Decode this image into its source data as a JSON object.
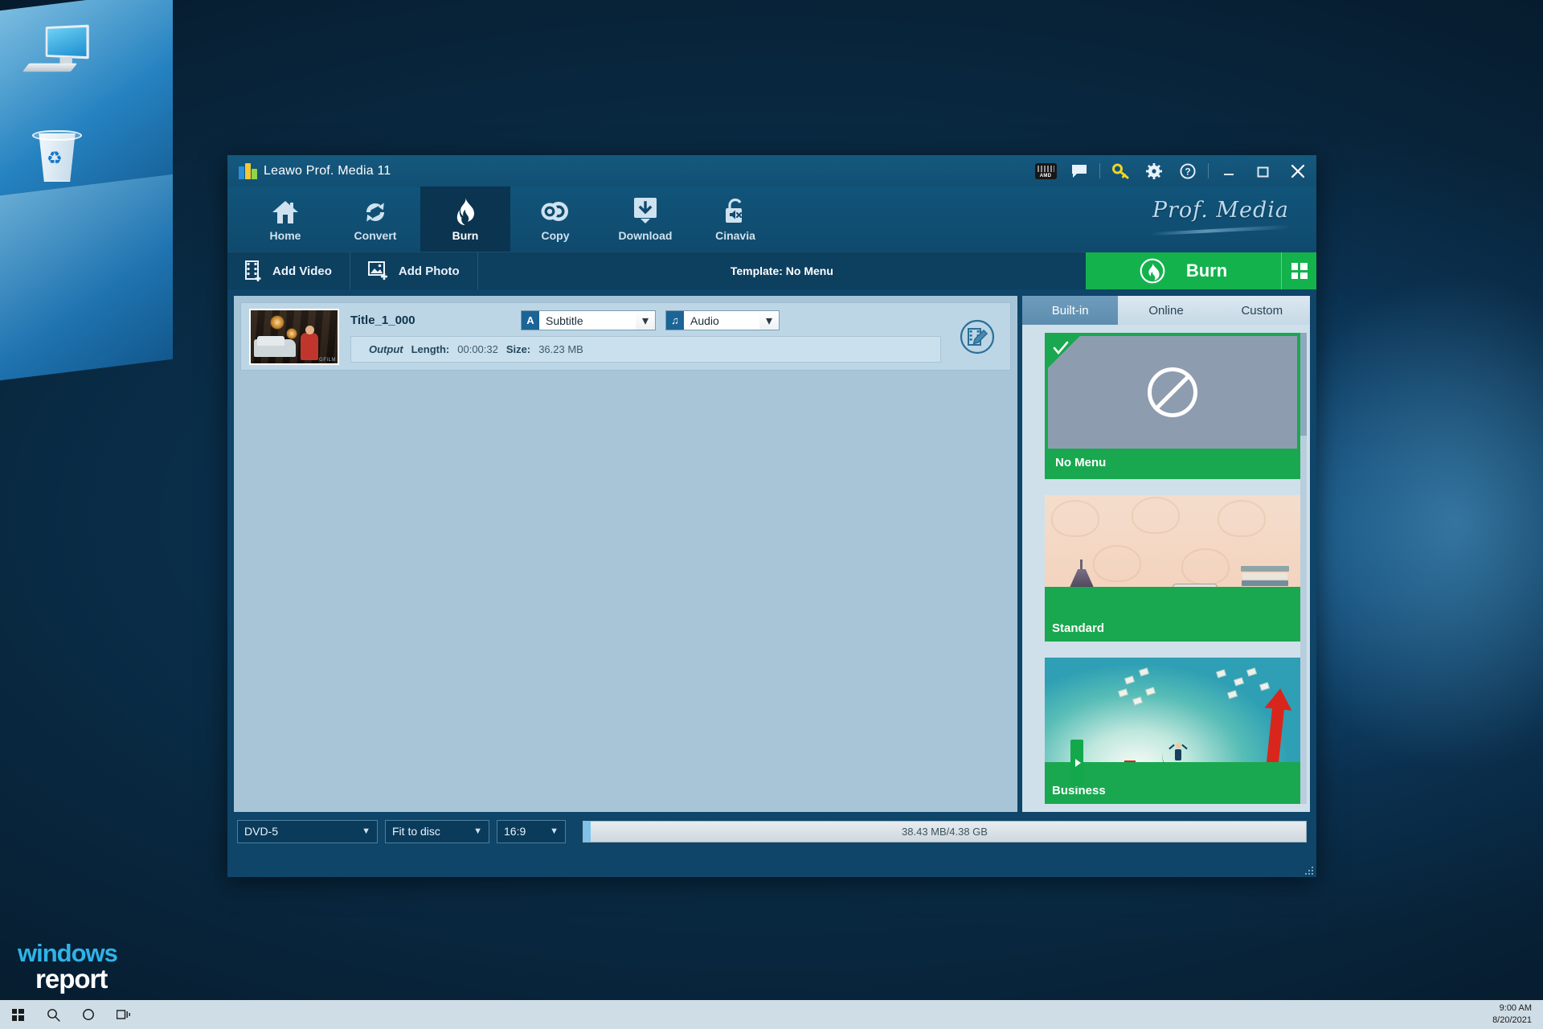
{
  "desktop": {
    "icons": [
      {
        "name": "this-pc",
        "label": ""
      },
      {
        "name": "recycle-bin",
        "label": ""
      }
    ],
    "watermark": {
      "line1": "windows",
      "line2": "report"
    }
  },
  "taskbar": {
    "buttons": [
      {
        "icon": "windows-start-icon",
        "label": ""
      },
      {
        "icon": "search-icon",
        "label": ""
      },
      {
        "icon": "cortana-icon",
        "label": ""
      },
      {
        "icon": "task-view-icon",
        "label": ""
      }
    ],
    "clock": {
      "time": "9:00 AM",
      "date": "8/20/2021"
    }
  },
  "window": {
    "title": "Leawo Prof. Media 11",
    "brand": "Prof. Media",
    "title_actions": [
      {
        "name": "amd-badge",
        "icon": "amd-icon",
        "label": "AMD"
      },
      {
        "name": "feedback-button",
        "icon": "speech-bubble-icon"
      },
      {
        "name": "register-button",
        "icon": "key-icon"
      },
      {
        "name": "settings-button",
        "icon": "gear-icon"
      },
      {
        "name": "help-button",
        "icon": "question-mark-icon"
      },
      {
        "name": "minimize-button",
        "icon": "minimize-icon"
      },
      {
        "name": "maximize-button",
        "icon": "maximize-icon"
      },
      {
        "name": "close-button",
        "icon": "close-icon"
      }
    ]
  },
  "nav": {
    "items": [
      {
        "label": "Home",
        "icon": "home-icon",
        "active": false
      },
      {
        "label": "Convert",
        "icon": "convert-arrows-icon",
        "active": false
      },
      {
        "label": "Burn",
        "icon": "flame-icon",
        "active": true
      },
      {
        "label": "Copy",
        "icon": "disc-icon",
        "active": false
      },
      {
        "label": "Download",
        "icon": "download-icon",
        "active": false
      },
      {
        "label": "Cinavia",
        "icon": "unlock-mute-icon",
        "active": false
      }
    ]
  },
  "toolbar": {
    "add_video_label": "Add Video",
    "add_photo_label": "Add Photo",
    "template_label": "Template: No Menu",
    "burn_label": "Burn"
  },
  "file": {
    "title": "Title_1_000",
    "subtitle_select": {
      "value": "Subtitle",
      "badge": "A"
    },
    "audio_select": {
      "value": "Audio",
      "badge": "♫"
    },
    "output_label": "Output",
    "length_label": "Length:",
    "length_value": "00:00:32",
    "size_label": "Size:",
    "size_value": "36.23 MB"
  },
  "panel": {
    "tabs": [
      {
        "label": "Built-in",
        "active": true
      },
      {
        "label": "Online",
        "active": false
      },
      {
        "label": "Custom",
        "active": false
      }
    ],
    "templates": [
      {
        "name": "No Menu",
        "selected": true
      },
      {
        "name": "Standard",
        "selected": false
      },
      {
        "name": "Business",
        "selected": false
      }
    ]
  },
  "bottom": {
    "disc_type": "DVD-5",
    "fit_mode": "Fit to disc",
    "aspect_ratio": "16:9",
    "capacity": "38.43 MB/4.38 GB"
  },
  "colors": {
    "accent_green": "#13b24d",
    "window_blue": "#0e4568",
    "titlebar_blue": "#15597f",
    "panel_blue": "#cfe0eb",
    "list_blue": "#a8c5d8"
  }
}
